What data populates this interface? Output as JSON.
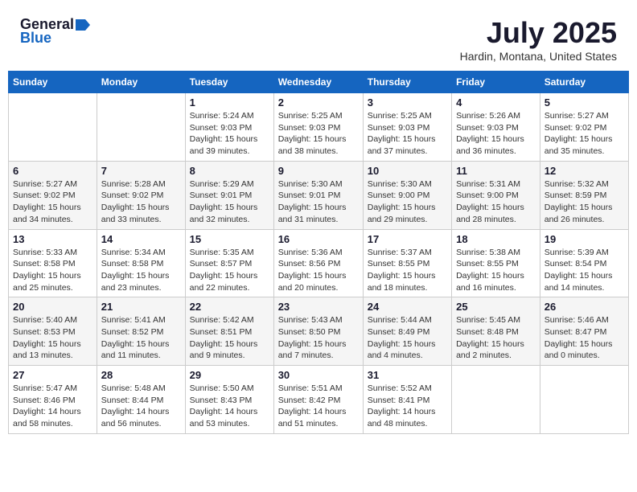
{
  "header": {
    "logo_general": "General",
    "logo_blue": "Blue",
    "month_year": "July 2025",
    "location": "Hardin, Montana, United States"
  },
  "days_of_week": [
    "Sunday",
    "Monday",
    "Tuesday",
    "Wednesday",
    "Thursday",
    "Friday",
    "Saturday"
  ],
  "weeks": [
    [
      {
        "day": "",
        "info": ""
      },
      {
        "day": "",
        "info": ""
      },
      {
        "day": "1",
        "info": "Sunrise: 5:24 AM\nSunset: 9:03 PM\nDaylight: 15 hours\nand 39 minutes."
      },
      {
        "day": "2",
        "info": "Sunrise: 5:25 AM\nSunset: 9:03 PM\nDaylight: 15 hours\nand 38 minutes."
      },
      {
        "day": "3",
        "info": "Sunrise: 5:25 AM\nSunset: 9:03 PM\nDaylight: 15 hours\nand 37 minutes."
      },
      {
        "day": "4",
        "info": "Sunrise: 5:26 AM\nSunset: 9:03 PM\nDaylight: 15 hours\nand 36 minutes."
      },
      {
        "day": "5",
        "info": "Sunrise: 5:27 AM\nSunset: 9:02 PM\nDaylight: 15 hours\nand 35 minutes."
      }
    ],
    [
      {
        "day": "6",
        "info": "Sunrise: 5:27 AM\nSunset: 9:02 PM\nDaylight: 15 hours\nand 34 minutes."
      },
      {
        "day": "7",
        "info": "Sunrise: 5:28 AM\nSunset: 9:02 PM\nDaylight: 15 hours\nand 33 minutes."
      },
      {
        "day": "8",
        "info": "Sunrise: 5:29 AM\nSunset: 9:01 PM\nDaylight: 15 hours\nand 32 minutes."
      },
      {
        "day": "9",
        "info": "Sunrise: 5:30 AM\nSunset: 9:01 PM\nDaylight: 15 hours\nand 31 minutes."
      },
      {
        "day": "10",
        "info": "Sunrise: 5:30 AM\nSunset: 9:00 PM\nDaylight: 15 hours\nand 29 minutes."
      },
      {
        "day": "11",
        "info": "Sunrise: 5:31 AM\nSunset: 9:00 PM\nDaylight: 15 hours\nand 28 minutes."
      },
      {
        "day": "12",
        "info": "Sunrise: 5:32 AM\nSunset: 8:59 PM\nDaylight: 15 hours\nand 26 minutes."
      }
    ],
    [
      {
        "day": "13",
        "info": "Sunrise: 5:33 AM\nSunset: 8:58 PM\nDaylight: 15 hours\nand 25 minutes."
      },
      {
        "day": "14",
        "info": "Sunrise: 5:34 AM\nSunset: 8:58 PM\nDaylight: 15 hours\nand 23 minutes."
      },
      {
        "day": "15",
        "info": "Sunrise: 5:35 AM\nSunset: 8:57 PM\nDaylight: 15 hours\nand 22 minutes."
      },
      {
        "day": "16",
        "info": "Sunrise: 5:36 AM\nSunset: 8:56 PM\nDaylight: 15 hours\nand 20 minutes."
      },
      {
        "day": "17",
        "info": "Sunrise: 5:37 AM\nSunset: 8:55 PM\nDaylight: 15 hours\nand 18 minutes."
      },
      {
        "day": "18",
        "info": "Sunrise: 5:38 AM\nSunset: 8:55 PM\nDaylight: 15 hours\nand 16 minutes."
      },
      {
        "day": "19",
        "info": "Sunrise: 5:39 AM\nSunset: 8:54 PM\nDaylight: 15 hours\nand 14 minutes."
      }
    ],
    [
      {
        "day": "20",
        "info": "Sunrise: 5:40 AM\nSunset: 8:53 PM\nDaylight: 15 hours\nand 13 minutes."
      },
      {
        "day": "21",
        "info": "Sunrise: 5:41 AM\nSunset: 8:52 PM\nDaylight: 15 hours\nand 11 minutes."
      },
      {
        "day": "22",
        "info": "Sunrise: 5:42 AM\nSunset: 8:51 PM\nDaylight: 15 hours\nand 9 minutes."
      },
      {
        "day": "23",
        "info": "Sunrise: 5:43 AM\nSunset: 8:50 PM\nDaylight: 15 hours\nand 7 minutes."
      },
      {
        "day": "24",
        "info": "Sunrise: 5:44 AM\nSunset: 8:49 PM\nDaylight: 15 hours\nand 4 minutes."
      },
      {
        "day": "25",
        "info": "Sunrise: 5:45 AM\nSunset: 8:48 PM\nDaylight: 15 hours\nand 2 minutes."
      },
      {
        "day": "26",
        "info": "Sunrise: 5:46 AM\nSunset: 8:47 PM\nDaylight: 15 hours\nand 0 minutes."
      }
    ],
    [
      {
        "day": "27",
        "info": "Sunrise: 5:47 AM\nSunset: 8:46 PM\nDaylight: 14 hours\nand 58 minutes."
      },
      {
        "day": "28",
        "info": "Sunrise: 5:48 AM\nSunset: 8:44 PM\nDaylight: 14 hours\nand 56 minutes."
      },
      {
        "day": "29",
        "info": "Sunrise: 5:50 AM\nSunset: 8:43 PM\nDaylight: 14 hours\nand 53 minutes."
      },
      {
        "day": "30",
        "info": "Sunrise: 5:51 AM\nSunset: 8:42 PM\nDaylight: 14 hours\nand 51 minutes."
      },
      {
        "day": "31",
        "info": "Sunrise: 5:52 AM\nSunset: 8:41 PM\nDaylight: 14 hours\nand 48 minutes."
      },
      {
        "day": "",
        "info": ""
      },
      {
        "day": "",
        "info": ""
      }
    ]
  ]
}
